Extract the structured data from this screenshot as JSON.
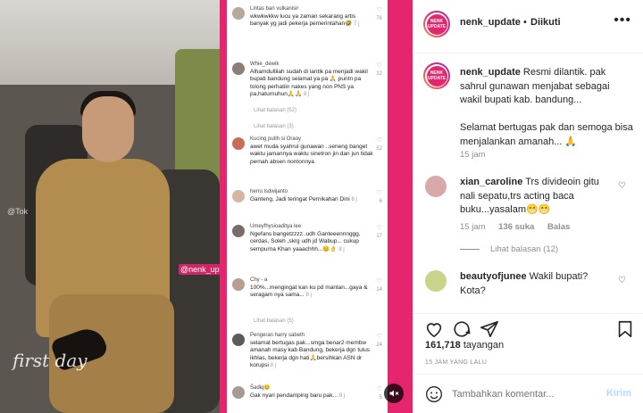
{
  "video": {
    "watermark": "@nenk_update",
    "cursive_text": "first day",
    "tag_text": "@Tok"
  },
  "screenshot_comments": [
    {
      "name": "Lintas ban vulkanisir",
      "text": "wkwkwkkw lucu ya zaman sekarang artis banyak yg jadi pekerja pemerintahan🤣",
      "meta": "7 j",
      "likes": "76",
      "replies": ""
    },
    {
      "name": "Whie_dewik",
      "text": "Alhamdullilah sudah di lantik pa menjadi wakil bupati bandung selamat ya pa 🙏 puntn pa tolong perhatiin nakes yang non PNS ya pa,haturnuhun🙏🙏",
      "meta": "8 j",
      "likes": "32",
      "replies": "Lihat balasan (52)"
    },
    {
      "name": "Kucing putih si Oraoy",
      "text": "awet muda syahrul gunawan ..seneng banget waktu jamannya waktu sinetron jin dan jun tidak pernah absen nontonnya",
      "meta": "",
      "likes": "52",
      "replies": "Lihat balasan (3)"
    },
    {
      "name": "herru lsdwijanto",
      "text": "Ganteng. Jadi teringat Pernikahan Dini",
      "meta": "8 j",
      "likes": "6",
      "replies": ""
    },
    {
      "name": "Umeyfhysioaditya lee",
      "text": "Ngefans bangetzzzz..udh Ganteeennnggg, cerdas, Soleh ,skrg udh jd Wabup... cukup sempurna Khan yaaachhh...😊👌",
      "meta": "8 j",
      "likes": "17",
      "replies": ""
    },
    {
      "name": "Chy - a",
      "text": "100%...mengingat kan ku pd mantan...gaya & seragam nya sama...",
      "meta": "8 j",
      "likes": "14",
      "replies": "Lihat balasan (5)"
    },
    {
      "name": "Pengeran harry sabeth",
      "text": "selamat bertugas pak...smga benar2 membw amanah masy kab Bandung, bekerja dgn tulus ikhlas, bekerja dgn hati🙏bersihkan ASN dr korupsi",
      "meta": "8 j",
      "likes": "24",
      "replies": ""
    },
    {
      "name": "Ŝaɗɨɋ😊",
      "text": "Gak nyari pendamping baru pak...",
      "meta": "9 j",
      "likes": "5",
      "replies": ""
    }
  ],
  "header": {
    "username": "nenk_update",
    "separator": "•",
    "follow_label": "Diikuti",
    "more_label": "•••",
    "avatar_text": "NENK UPDATE"
  },
  "caption": {
    "username": "nenk_update",
    "text": "Resmi dilantik. pak sahrul gunawan menjabat sebagai wakil bupati kab. bandung...",
    "text2": "Selamat bertugas pak dan semoga bisa menjalankan amanah... 🙏",
    "time": "15 jam"
  },
  "comments": [
    {
      "username": "xian_caroline",
      "text": "Trs divideoin gitu nali sepatu,trs acting baca buku...yasalam😁😁",
      "time": "15 jam",
      "likes": "136 suka",
      "reply_label": "Balas",
      "view_replies": "Lihat balasan (12)",
      "avatar_color": "#d9a8a8"
    },
    {
      "username": "beautyofjunee",
      "text": "Wakil bupati? Kota?",
      "time": "",
      "likes": "",
      "reply_label": "",
      "view_replies": "",
      "avatar_color": "#c9d48a"
    }
  ],
  "stats": {
    "views": "161,718",
    "views_label": "tayangan",
    "date": "15 JAM YANG LALU"
  },
  "composer": {
    "placeholder": "Tambahkan komentar...",
    "send_label": "Kirim"
  },
  "colors": {
    "background_pink": "#e5266f",
    "send_disabled": "#b3dbff",
    "meta_gray": "#8e8e8e"
  }
}
